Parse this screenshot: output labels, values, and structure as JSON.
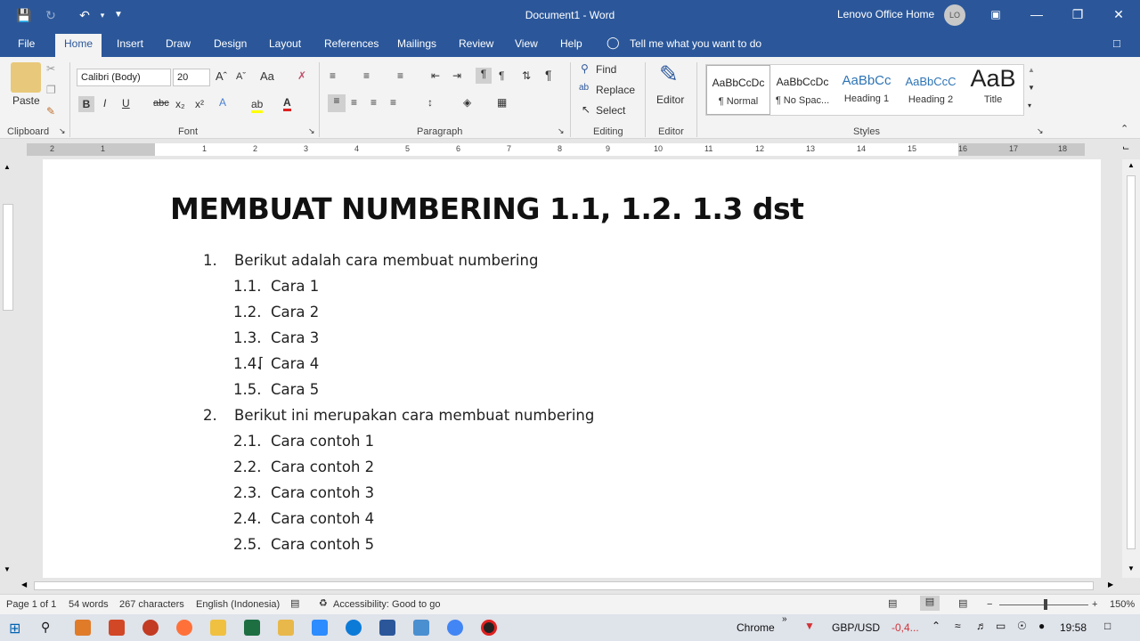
{
  "window": {
    "doc_title": "Document1  -  Word",
    "user": "Lenovo Office Home",
    "avatar_initials": "LO"
  },
  "tabs": [
    "File",
    "Home",
    "Insert",
    "Draw",
    "Design",
    "Layout",
    "References",
    "Mailings",
    "Review",
    "View",
    "Help"
  ],
  "active_tab": "Home",
  "tell_me": "Tell me what you want to do",
  "ribbon": {
    "clipboard": {
      "paste": "Paste",
      "label": "Clipboard"
    },
    "font": {
      "name": "Calibri (Body)",
      "size": "20",
      "label": "Font"
    },
    "paragraph": {
      "label": "Paragraph"
    },
    "editing": {
      "find": "Find",
      "replace": "Replace",
      "select": "Select",
      "label": "Editing"
    },
    "editor": {
      "button": "Editor",
      "label": "Editor"
    },
    "styles": {
      "label": "Styles",
      "items": [
        {
          "preview": "AaBbCcDc",
          "name": "¶ Normal"
        },
        {
          "preview": "AaBbCcDc",
          "name": "¶ No Spac..."
        },
        {
          "preview": "AaBbCc",
          "name": "Heading 1"
        },
        {
          "preview": "AaBbCcC",
          "name": "Heading 2"
        },
        {
          "preview": "AaB",
          "name": "Title"
        }
      ]
    }
  },
  "ruler_numbers": [
    "2",
    "1",
    "1",
    "2",
    "3",
    "4",
    "5",
    "6",
    "7",
    "8",
    "9",
    "10",
    "11",
    "12",
    "13",
    "14",
    "15",
    "16",
    "17",
    "18"
  ],
  "document": {
    "title": "MEMBUAT NUMBERING 1.1, 1.2. 1.3 dst",
    "items": [
      {
        "num": "1.",
        "text": "Berikut adalah cara membuat numbering",
        "level": 1
      },
      {
        "num": "1.1.",
        "text": "Cara 1",
        "level": 2
      },
      {
        "num": "1.2.",
        "text": "Cara 2",
        "level": 2
      },
      {
        "num": "1.3.",
        "text": "Cara 3",
        "level": 2
      },
      {
        "num": "1.4.",
        "text": "Cara 4",
        "level": 2
      },
      {
        "num": "1.5.",
        "text": "Cara 5",
        "level": 2
      },
      {
        "num": "2.",
        "text": "Berikut ini merupakan cara membuat numbering",
        "level": 1
      },
      {
        "num": "2.1.",
        "text": "Cara contoh 1",
        "level": 2
      },
      {
        "num": "2.2.",
        "text": "Cara contoh 2",
        "level": 2
      },
      {
        "num": "2.3.",
        "text": "Cara contoh 3",
        "level": 2
      },
      {
        "num": "2.4.",
        "text": "Cara contoh 4",
        "level": 2
      },
      {
        "num": "2.5.",
        "text": "Cara contoh 5",
        "level": 2
      }
    ]
  },
  "status": {
    "page": "Page 1 of 1",
    "words": "54 words",
    "chars": "267 characters",
    "language": "English (Indonesia)",
    "accessibility": "Accessibility: Good to go",
    "zoom": "150%"
  },
  "taskbar": {
    "chrome": "Chrome",
    "ticker": "GBP/USD",
    "ticker_value": "-0,4...",
    "time": "19:58"
  },
  "colors": {
    "word_blue": "#2b579a",
    "ticker_red": "#d13438"
  }
}
